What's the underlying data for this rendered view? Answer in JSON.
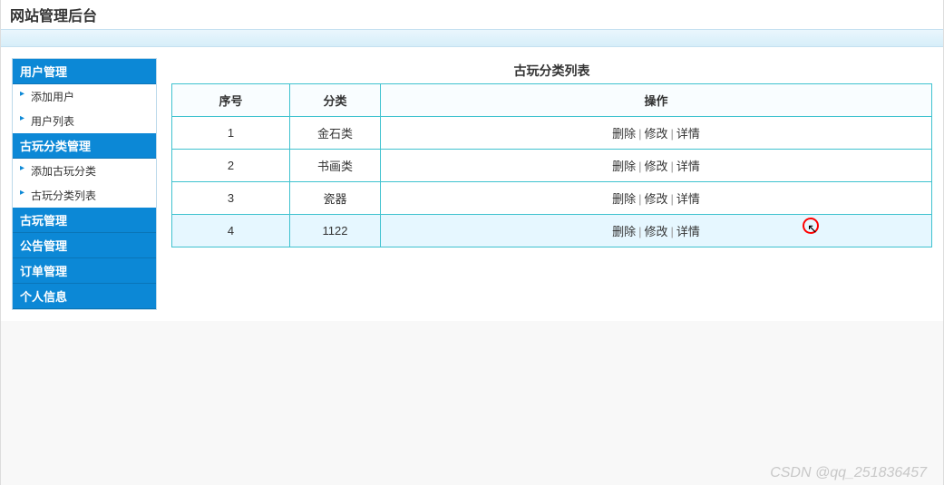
{
  "header": {
    "title": "网站管理后台"
  },
  "sidebar": [
    {
      "title": "用户管理",
      "items": [
        "添加用户",
        "用户列表"
      ]
    },
    {
      "title": "古玩分类管理",
      "items": [
        "添加古玩分类",
        "古玩分类列表"
      ]
    },
    {
      "title": "古玩管理",
      "items": []
    },
    {
      "title": "公告管理",
      "items": []
    },
    {
      "title": "订单管理",
      "items": []
    },
    {
      "title": "个人信息",
      "items": []
    }
  ],
  "content": {
    "title": "古玩分类列表",
    "columns": [
      "序号",
      "分类",
      "操作"
    ],
    "actions": {
      "delete": "删除",
      "edit": "修改",
      "detail": "详情"
    },
    "rows": [
      {
        "idx": "1",
        "cat": "金石类",
        "highlight": false
      },
      {
        "idx": "2",
        "cat": "书画类",
        "highlight": false
      },
      {
        "idx": "3",
        "cat": "瓷器",
        "highlight": false
      },
      {
        "idx": "4",
        "cat": "1122",
        "highlight": true
      }
    ]
  },
  "watermark": "CSDN @qq_251836457"
}
